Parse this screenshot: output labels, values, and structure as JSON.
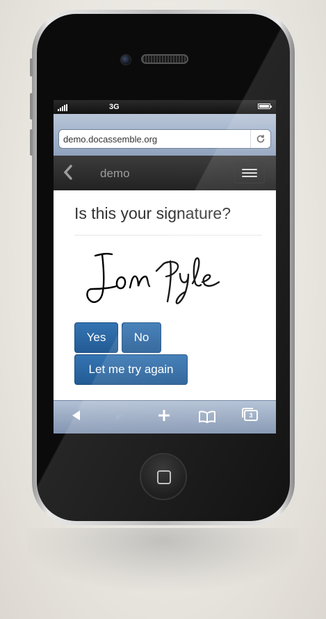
{
  "statusbar": {
    "network": "3G"
  },
  "browser": {
    "url": "demo.docassemble.org",
    "tabs_count": "3"
  },
  "navbar": {
    "brand": "demo"
  },
  "question": {
    "title": "Is this your signature?",
    "signature_alt": "Jon Pyle"
  },
  "buttons": {
    "yes": "Yes",
    "no": "No",
    "retry": "Let me try again"
  },
  "colors": {
    "button_primary": "#2c6aa8",
    "navbar": "#2f2f2f",
    "safari_chrome": "#8fa2bd"
  },
  "icons": [
    "back-chevron-icon",
    "menu-icon",
    "reload-icon",
    "back-icon",
    "forward-icon",
    "add-icon",
    "bookmarks-icon",
    "tabs-icon",
    "home-button"
  ]
}
